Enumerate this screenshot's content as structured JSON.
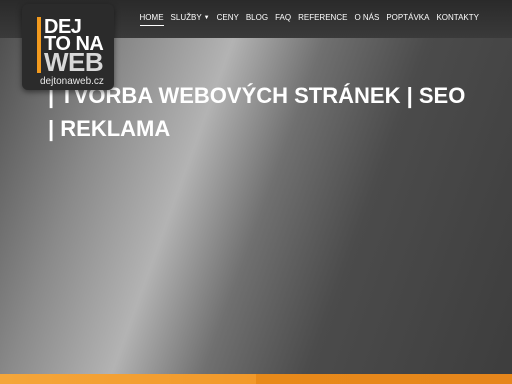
{
  "logo": {
    "line1": "DEJ",
    "line2": "TO NA",
    "line3": "WEB",
    "domain": "dejtonaweb.cz"
  },
  "nav": {
    "items": [
      {
        "label": "HOME",
        "active": true
      },
      {
        "label": "SLUŽBY",
        "has_dropdown": true
      },
      {
        "label": "CENY"
      },
      {
        "label": "BLOG"
      },
      {
        "label": "FAQ"
      },
      {
        "label": "REFERENCE"
      },
      {
        "label": "O NÁS"
      },
      {
        "label": "POPTÁVKA"
      },
      {
        "label": "KONTAKTY"
      }
    ]
  },
  "hero": {
    "title": "| TVORBA WEBOVÝCH STRÁNEK | SEO | REKLAMA"
  },
  "colors": {
    "accent": "#f29a1e",
    "topbar": "#333333",
    "text": "#ffffff"
  }
}
